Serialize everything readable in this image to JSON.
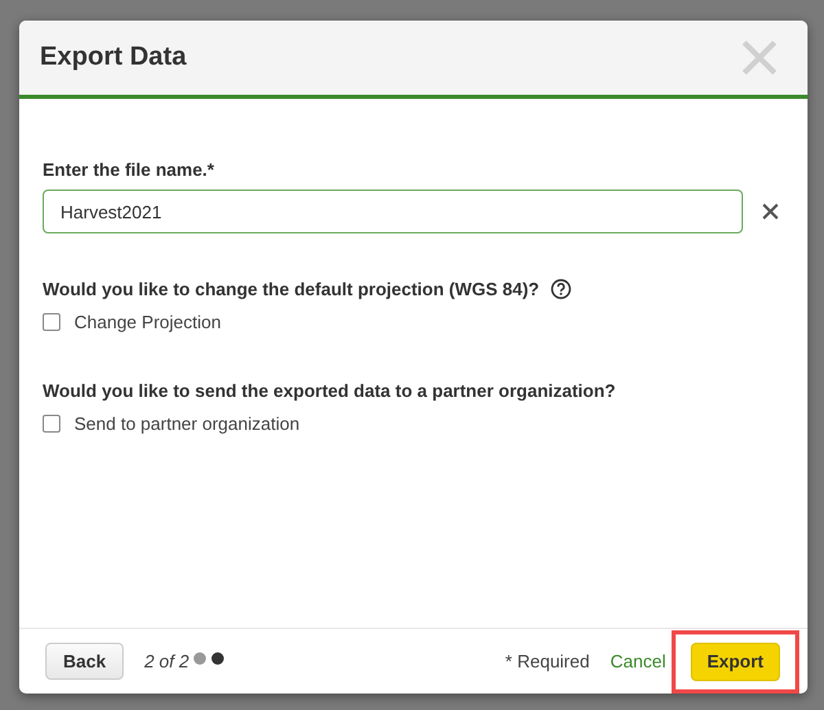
{
  "dialog": {
    "title": "Export Data"
  },
  "file_name": {
    "label": "Enter the file name.*",
    "value": "Harvest2021"
  },
  "questions": [
    {
      "text": "Would you like to change the default projection (WGS 84)?",
      "help": true,
      "option": {
        "label": "Change Projection",
        "checked": false
      }
    },
    {
      "text": "Would you like to send the exported data to a partner organization?",
      "help": false,
      "option": {
        "label": "Send to partner organization",
        "checked": false
      }
    }
  ],
  "footer": {
    "back": "Back",
    "step": "2 of 2",
    "steps": [
      {
        "selected": false
      },
      {
        "selected": true
      }
    ],
    "required_note": "* Required",
    "cancel": "Cancel",
    "export": {
      "label": "Export",
      "highlighted": true
    }
  }
}
